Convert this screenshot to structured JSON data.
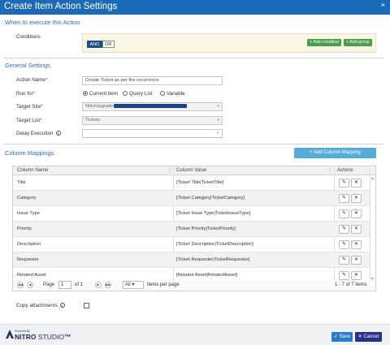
{
  "dialog": {
    "title": "Create Item Action Settings",
    "close_glyph": "×"
  },
  "when_section": {
    "heading": "When to execute this Action",
    "conditions_label": "Conditions",
    "toggle": {
      "and": "AND",
      "or": "OR"
    },
    "add_condition": "+ Add condition",
    "add_group": "+ Add group"
  },
  "general": {
    "heading": "General Settings",
    "action_name": {
      "label": "Action Name",
      "value": "Create Ticket as per the recurrence"
    },
    "run_for": {
      "label": "Run for",
      "options": [
        "Current Item",
        "Query List",
        "Variable"
      ],
      "selected": "Current Item"
    },
    "target_site": {
      "label": "Target Site",
      "value": "NitroUpgrade"
    },
    "target_list": {
      "label": "Target List",
      "value": "Tickets"
    },
    "delay_execution": {
      "label": "Delay Execution",
      "value": ""
    }
  },
  "column_mappings": {
    "heading": "Column Mappings",
    "add_button": "+ Add Column Mapping",
    "headers": [
      "Column Name",
      "Column Value",
      "Actions"
    ],
    "rows": [
      {
        "name": "Title",
        "value": "[Ticket Title|TicketTitle]"
      },
      {
        "name": "Category",
        "value": "[Ticket Category|TicketCategory]"
      },
      {
        "name": "Issue Type",
        "value": "[Ticket Issue Type|TicketIssueType]"
      },
      {
        "name": "Priority",
        "value": "[Ticket Priority|TicketPriority]"
      },
      {
        "name": "Description",
        "value": "[Ticket Description|TicketDescription]"
      },
      {
        "name": "Requester",
        "value": "[Ticket Requester|TicketRequester]"
      },
      {
        "name": "Related Asset",
        "value": "[Related Asset|RelatedAsset]"
      }
    ],
    "pager": {
      "page_label": "Page",
      "page": "1",
      "of_label": "of 1",
      "page_size": "All",
      "items_per_page": "items per page",
      "summary": "1 - 7 of 7 items"
    }
  },
  "copy_attachments": {
    "label": "Copy attachments",
    "checked": false
  },
  "footer": {
    "powered_by": "Powered By",
    "brand": "NITRO",
    "brand_suffix": "STUDIO",
    "trademark": "™",
    "save": "Save",
    "cancel": "Cancel"
  },
  "icons": {
    "info": "info-icon",
    "edit": "pencil-icon",
    "delete": "close-icon"
  },
  "colors": {
    "title_bar": "#1b6ab8",
    "section_heading": "#2a6fb8",
    "green_button": "#4a9d4a",
    "add_mapping_button": "#57abd8",
    "save_button": "#2c7cc5",
    "cancel_button": "#2a2f8a"
  }
}
